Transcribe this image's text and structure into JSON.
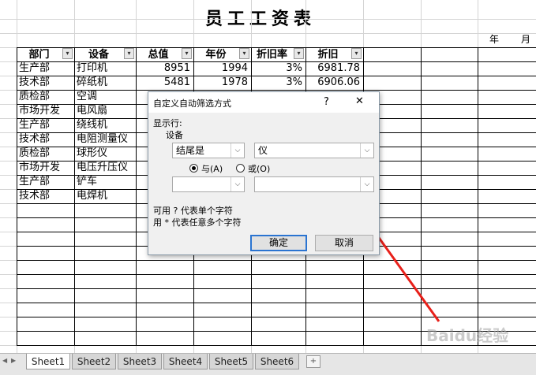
{
  "sheet": {
    "title": "员工工资表",
    "year_label": "年",
    "month_label": "月",
    "columns": [
      {
        "label": "部门"
      },
      {
        "label": "设备"
      },
      {
        "label": "总值"
      },
      {
        "label": "年份"
      },
      {
        "label": "折旧率"
      },
      {
        "label": "折旧"
      }
    ],
    "rows": [
      [
        "生产部",
        "打印机",
        "8951",
        "1994",
        "3%",
        "6981.78"
      ],
      [
        "技术部",
        "碎纸机",
        "5481",
        "1978",
        "3%",
        "6906.06"
      ],
      [
        "质检部",
        "空调",
        "",
        "",
        "",
        ""
      ],
      [
        "市场开发",
        "电风扇",
        "",
        "",
        "",
        ""
      ],
      [
        "生产部",
        "绕线机",
        "",
        "",
        "",
        ""
      ],
      [
        "技术部",
        "电阻测量仪",
        "",
        "",
        "",
        ""
      ],
      [
        "质检部",
        "球形仪",
        "",
        "",
        "",
        ""
      ],
      [
        "市场开发",
        "电压升压仪",
        "",
        "",
        "",
        ""
      ],
      [
        "生产部",
        "铲车",
        "",
        "",
        "",
        ""
      ],
      [
        "技术部",
        "电焊机",
        "",
        "",
        "",
        ""
      ]
    ],
    "filter_arrow": "▾"
  },
  "dialog": {
    "title": "自定义自动筛选方式",
    "help": "?",
    "close": "✕",
    "show_rows": "显示行:",
    "field": "设备",
    "cond1_operator": "结尾是",
    "cond1_value": "仪",
    "and_label": "与(A)",
    "or_label": "或(O)",
    "logic_selected": "and",
    "cond2_operator": "",
    "cond2_value": "",
    "hint1": "可用 ? 代表单个字符",
    "hint2": "用 * 代表任意多个字符",
    "ok": "确定",
    "cancel": "取消",
    "combo_arrow": "⌵"
  },
  "annotation": {
    "color": "#e8201a"
  },
  "tabs": [
    "Sheet1",
    "Sheet2",
    "Sheet3",
    "Sheet4",
    "Sheet5",
    "Sheet6"
  ],
  "active_tab": 0,
  "watermark": "Baidu经验"
}
